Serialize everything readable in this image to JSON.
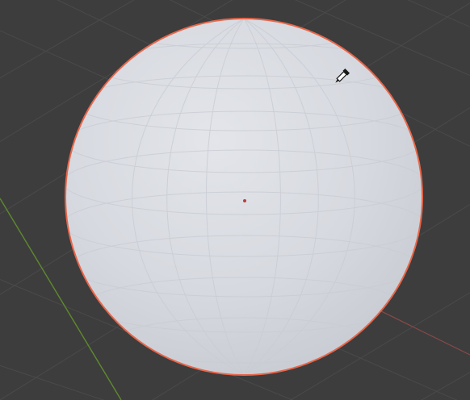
{
  "viewport": {
    "background_color": "#3d3d3d",
    "grid_color": "#4a4a4a",
    "x_axis_color": "#8a4a4a",
    "y_axis_color": "#5e8a2e"
  },
  "object": {
    "type": "uv-sphere",
    "selected": true,
    "fill_color": "#d8dbe0",
    "outline_color": "#e8664a",
    "origin_color": "#c23a3a"
  },
  "cursor": {
    "icon": "eyedropper-icon"
  }
}
